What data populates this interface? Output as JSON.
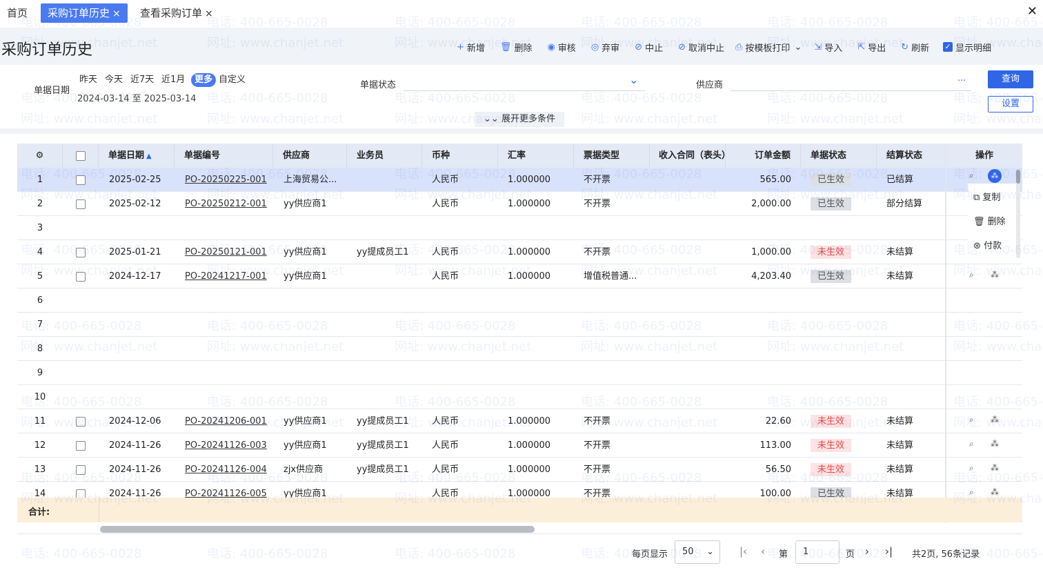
{
  "tabs": [
    {
      "label": "首页"
    },
    {
      "label": "采购订单历史",
      "close": "×"
    },
    {
      "label": "查看采购订单",
      "close": "×"
    }
  ],
  "window_close": "✕",
  "page": {
    "title": "采购订单历史"
  },
  "toolbar": {
    "add": "新增",
    "delete": "删除",
    "audit": "审核",
    "unaudit": "弃审",
    "stop": "中止",
    "unstop": "取消中止",
    "print": "按模板打印",
    "import": "导入",
    "export": "导出",
    "refresh": "刷新",
    "show_detail": "显示明细"
  },
  "filter": {
    "date_label": "单据日期",
    "chips": [
      "昨天",
      "今天",
      "近7天",
      "近1月",
      "更多",
      "自定义"
    ],
    "date_range": "2024-03-14 至 2025-03-14",
    "status_label": "单据状态",
    "supplier_label": "供应商",
    "supplier_more": "···",
    "query_button": "查询",
    "settings_button": "设置",
    "expand_label": "展开更多条件"
  },
  "grid": {
    "headers": [
      "单据日期",
      "单据编号",
      "供应商",
      "业务员",
      "币种",
      "汇率",
      "票据类型",
      "收入合同（表头）",
      "订单金额",
      "单据状态",
      "结算状态",
      "操作"
    ],
    "rows": [
      {
        "idx": "1",
        "date": "2025-02-25",
        "code": "PO-20250225-001",
        "supplier": "上海贸易公...",
        "staff": "",
        "currency": "人民币",
        "rate": "1.000000",
        "invoice": "不开票",
        "amount": "565.00",
        "status": "已生效",
        "status_type": "ok",
        "settle": "已结算"
      },
      {
        "idx": "2",
        "date": "2025-02-12",
        "code": "PO-20250212-001",
        "supplier": "yy供应商1",
        "staff": "",
        "currency": "人民币",
        "rate": "1.000000",
        "invoice": "不开票",
        "amount": "2,000.00",
        "status": "已生效",
        "status_type": "ok",
        "settle": "部分结算"
      },
      {
        "idx": "3"
      },
      {
        "idx": "4",
        "date": "2025-01-21",
        "code": "PO-20250121-001",
        "supplier": "yy供应商1",
        "staff": "yy提成员工1",
        "currency": "人民币",
        "rate": "1.000000",
        "invoice": "不开票",
        "amount": "1,000.00",
        "status": "未生效",
        "status_type": "no",
        "settle": "未结算"
      },
      {
        "idx": "5",
        "date": "2024-12-17",
        "code": "PO-20241217-001",
        "supplier": "yy供应商1",
        "staff": "",
        "currency": "人民币",
        "rate": "1.000000",
        "invoice": "增值税普通...",
        "amount": "4,203.40",
        "status": "已生效",
        "status_type": "ok",
        "settle": "未结算"
      },
      {
        "idx": "6"
      },
      {
        "idx": "7"
      },
      {
        "idx": "8"
      },
      {
        "idx": "9"
      },
      {
        "idx": "10"
      },
      {
        "idx": "11",
        "date": "2024-12-06",
        "code": "PO-20241206-001",
        "supplier": "yy供应商1",
        "staff": "yy提成员工1",
        "currency": "人民币",
        "rate": "1.000000",
        "invoice": "不开票",
        "amount": "22.60",
        "status": "未生效",
        "status_type": "no",
        "settle": "未结算"
      },
      {
        "idx": "12",
        "date": "2024-11-26",
        "code": "PO-20241126-003",
        "supplier": "yy供应商1",
        "staff": "yy提成员工1",
        "currency": "人民币",
        "rate": "1.000000",
        "invoice": "不开票",
        "amount": "113.00",
        "status": "未生效",
        "status_type": "no",
        "settle": "未结算"
      },
      {
        "idx": "13",
        "date": "2024-11-26",
        "code": "PO-20241126-004",
        "supplier": "zjx供应商",
        "staff": "yy提成员工1",
        "currency": "人民币",
        "rate": "1.000000",
        "invoice": "不开票",
        "amount": "56.50",
        "status": "未生效",
        "status_type": "no",
        "settle": "未结算"
      },
      {
        "idx": "14",
        "date": "2024-11-26",
        "code": "PO-20241126-005",
        "supplier": "yy供应商1",
        "staff": "",
        "currency": "人民币",
        "rate": "1.000000",
        "invoice": "不开票",
        "amount": "100.00",
        "status": "已生效",
        "status_type": "ok",
        "settle": "未结算"
      }
    ],
    "op_menu": [
      "复制",
      "删除",
      "付款"
    ],
    "total_label": "合计:"
  },
  "pager": {
    "per_page_label": "每页显示",
    "per_page_value": "50",
    "page_prefix": "第",
    "page_value": "1",
    "page_suffix": "页",
    "summary": "共2页, 56条记录"
  },
  "watermark": {
    "phone": "电话: 400-665-0028",
    "site": "网址: www.chanjet.net"
  },
  "colors": {
    "accent": "#3066e6",
    "selected_row": "#d9e2fb",
    "total_bar": "#fcefd9",
    "ineffective": "#e84a4a"
  }
}
